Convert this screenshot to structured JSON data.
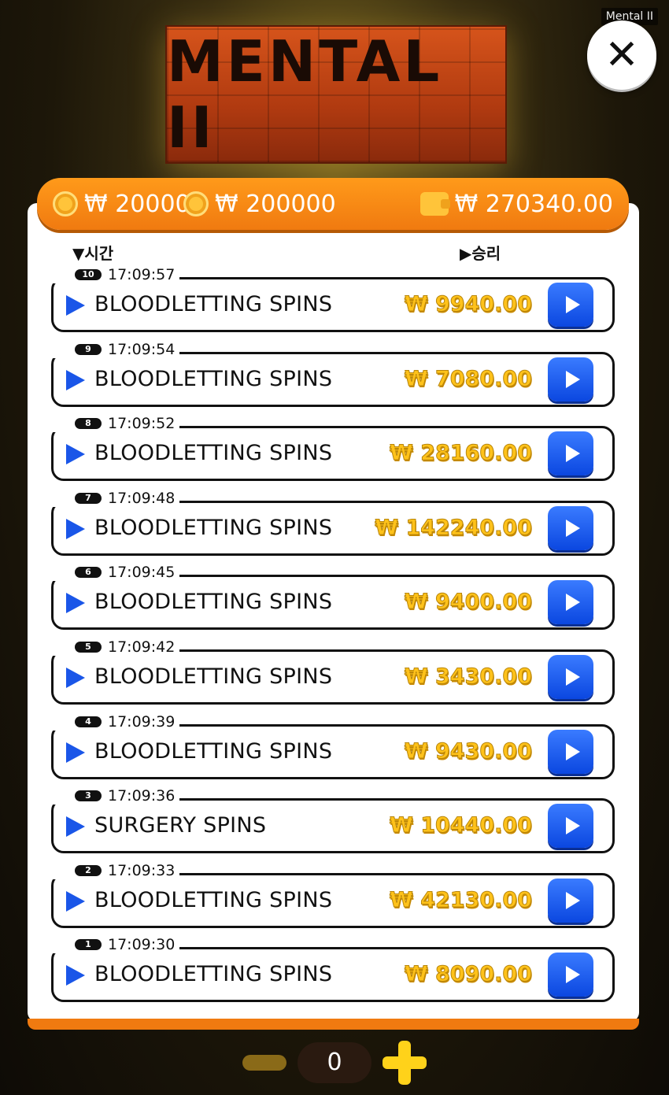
{
  "app_title": "Mental II",
  "logo_text": "MENTAL II",
  "balances": {
    "bet_min": "₩ 20000",
    "bet_max": "₩ 200000",
    "wallet": "₩ 270340.00"
  },
  "columns": {
    "time": "시간",
    "win": "승리"
  },
  "rows": [
    {
      "index": "10",
      "time": "17:09:57",
      "mode": "BLOODLETTING SPINS",
      "win": "₩ 9940.00"
    },
    {
      "index": "9",
      "time": "17:09:54",
      "mode": "BLOODLETTING SPINS",
      "win": "₩ 7080.00"
    },
    {
      "index": "8",
      "time": "17:09:52",
      "mode": "BLOODLETTING SPINS",
      "win": "₩ 28160.00"
    },
    {
      "index": "7",
      "time": "17:09:48",
      "mode": "BLOODLETTING SPINS",
      "win": "₩ 142240.00"
    },
    {
      "index": "6",
      "time": "17:09:45",
      "mode": "BLOODLETTING SPINS",
      "win": "₩ 9400.00"
    },
    {
      "index": "5",
      "time": "17:09:42",
      "mode": "BLOODLETTING SPINS",
      "win": "₩ 3430.00"
    },
    {
      "index": "4",
      "time": "17:09:39",
      "mode": "BLOODLETTING SPINS",
      "win": "₩ 9430.00"
    },
    {
      "index": "3",
      "time": "17:09:36",
      "mode": "SURGERY SPINS",
      "win": "₩ 10440.00"
    },
    {
      "index": "2",
      "time": "17:09:33",
      "mode": "BLOODLETTING SPINS",
      "win": "₩ 42130.00"
    },
    {
      "index": "1",
      "time": "17:09:30",
      "mode": "BLOODLETTING SPINS",
      "win": "₩ 8090.00"
    }
  ],
  "stepper": {
    "value": "0"
  },
  "colors": {
    "accent": "#f07a10",
    "play": "#1a56e8",
    "win": "#ffc21a"
  }
}
